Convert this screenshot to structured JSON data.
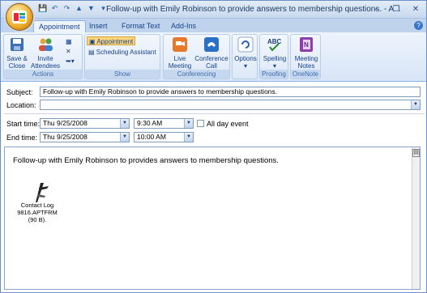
{
  "window": {
    "title": "Follow-up with Emily Robinson to provide answers to membership questions. - A...",
    "controls": {
      "minimize": "–",
      "restore": "❐",
      "close": "✕"
    }
  },
  "qat": {
    "save": "💾",
    "undo": "↶",
    "redo": "↷",
    "up": "▲",
    "down": "▼",
    "more": "▾"
  },
  "tabs": [
    "Appointment",
    "Insert",
    "Format Text",
    "Add-Ins"
  ],
  "ribbon": {
    "actions": {
      "label": "Actions",
      "save_close": "Save &\nClose",
      "invite": "Invite\nAttendees"
    },
    "show": {
      "label": "Show",
      "appointment": "Appointment",
      "scheduling": "Scheduling Assistant"
    },
    "conferencing": {
      "label": "Conferencing",
      "live_meeting": "Live\nMeeting",
      "conference_call": "Conference\nCall"
    },
    "options": {
      "label": "Options"
    },
    "proofing": {
      "label": "Proofing",
      "spelling": "Spelling"
    },
    "onenote": {
      "label": "OneNote",
      "meeting_notes": "Meeting\nNotes"
    }
  },
  "form": {
    "subject_label": "Subject:",
    "subject_value": "Follow-up with Emily Robinson to provide answers to membership questions.",
    "location_label": "Location:",
    "location_value": "",
    "start_label": "Start time:",
    "start_date": "Thu 9/25/2008",
    "start_time": "9:30 AM",
    "all_day_label": "All day event",
    "end_label": "End time:",
    "end_date": "Thu 9/25/2008",
    "end_time": "10:00 AM"
  },
  "body": {
    "text": "Follow-up with Emily Robinson to provides answers to membership questions.",
    "attachment_name": "Contact Log",
    "attachment_file": "9816.APTFRM (90 B)."
  }
}
